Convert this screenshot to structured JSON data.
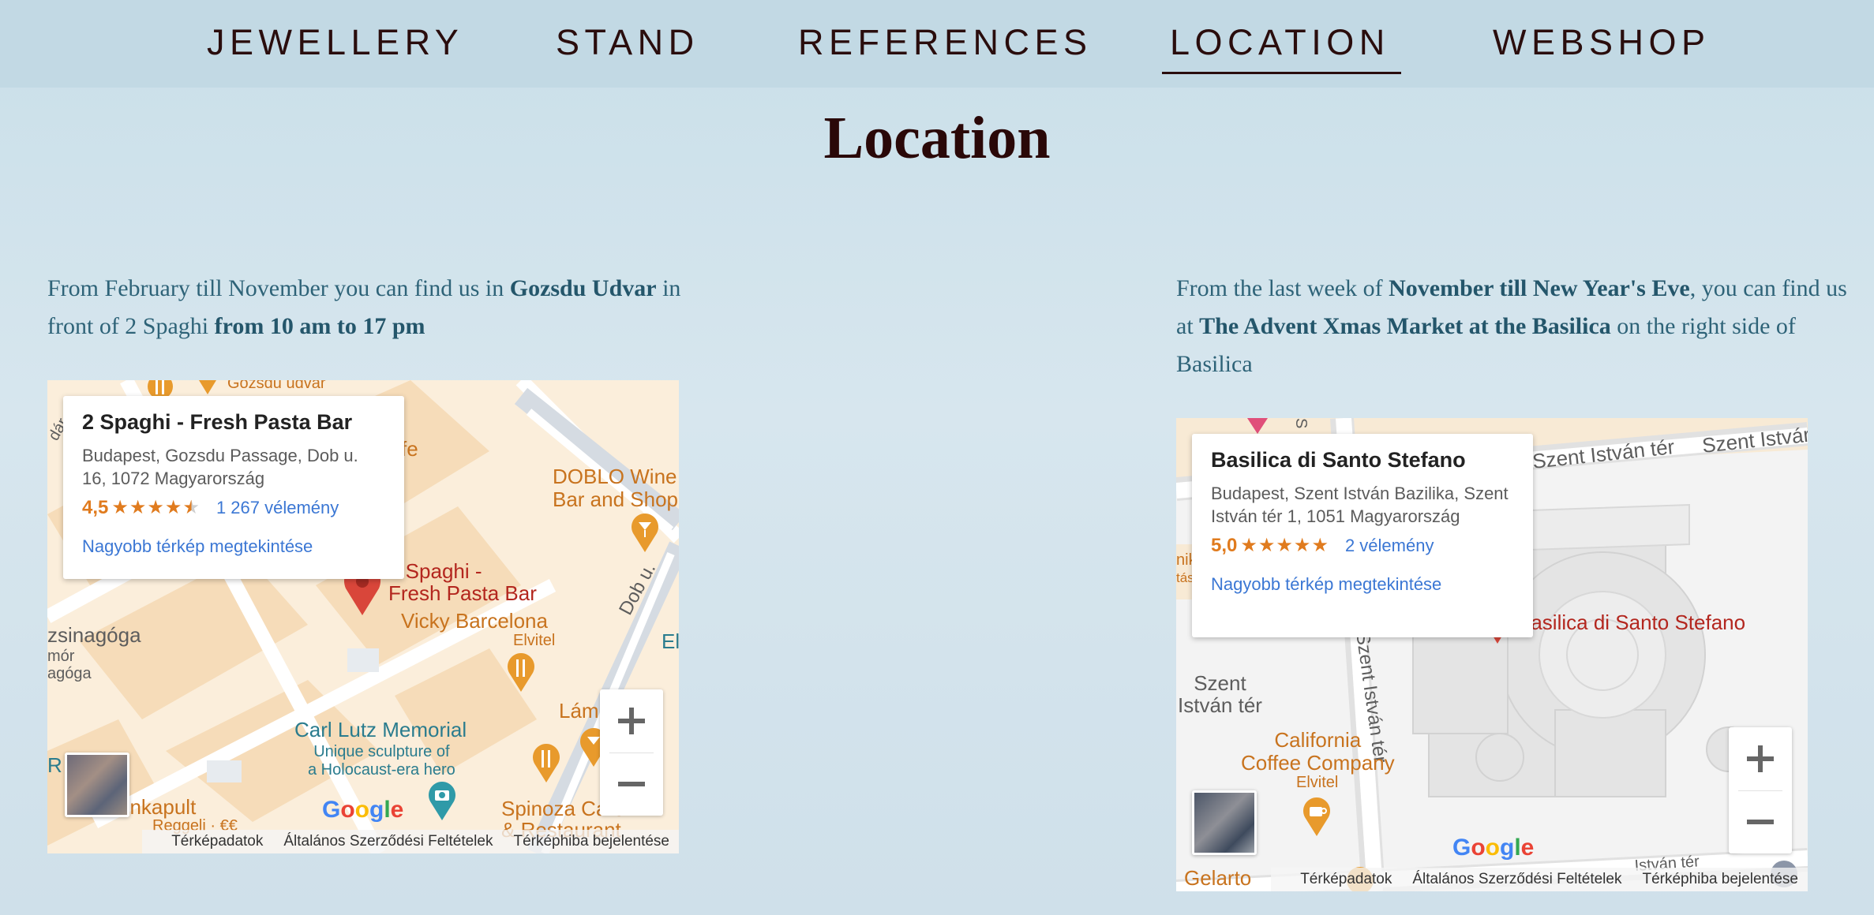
{
  "nav": {
    "items": [
      {
        "label": "JEWELLERY"
      },
      {
        "label": "STAND"
      },
      {
        "label": "REFERENCES"
      },
      {
        "label": "LOCATION"
      },
      {
        "label": "WEBSHOP"
      }
    ],
    "active": "LOCATION"
  },
  "page_title": "Location",
  "left": {
    "text_1": "From February till November you can find us in ",
    "text_bold_1": "Gozsdu Udvar",
    "text_2": " in front of 2 Spaghi ",
    "text_bold_2": "from 10 am to 17 pm",
    "map": {
      "card_name": "2 Spaghi - Fresh Pasta Bar",
      "card_address": "Budapest, Gozsdu Passage, Dob u. 16, 1072 Magyarország",
      "rating": "4,5",
      "stars": "★★★★★",
      "rating_fraction": 0.9,
      "reviews": "1 267 vélemény",
      "larger_map_link": "Nagyobb térkép megtekintése",
      "labels": {
        "place_marker": "2 Spaghi -\nFresh Pasta Bar",
        "doblo": "DOBLO Wine\nBar and Shop",
        "vicky": "Vicky Barcelona",
        "elvitel": "Elvitel",
        "zsinagoga": "zsinagóga",
        "mor": "mór",
        "agoga": "agóga",
        "carl_lutz": "Carl Lutz Memorial",
        "carl_lutz_sub": "Unique sculpture of\na Holocaust-era hero",
        "dob_u": "Dob u.",
        "lam": "Lám",
        "spinoza": "Spinoza Café\n& Restaurant",
        "r_haz": "R     ház",
        "onkapult": "onkapult",
        "regeli": "Reggeli · €€",
        "gozsdu_udvar": "Gozsdu udvar",
        "fe": "fe",
        "el": "El",
        "dar": "dár"
      },
      "footer": {
        "map_data": "Térképadatok",
        "terms": "Általános Szerződési Feltételek",
        "report": "Térképhiba bejelentése"
      },
      "google": "Google"
    }
  },
  "right": {
    "text_1": "From the last week of ",
    "text_bold_1": "November till New Year's Eve",
    "text_2": ", you can find us at ",
    "text_bold_2": "The Advent Xmas Market at the Basilica",
    "text_3": " on the right side of Basilica",
    "map": {
      "card_name": "Basilica di Santo Stefano",
      "card_address": "Budapest, Szent István Bazilika, Szent István tér 1, 1051 Magyarország",
      "rating": "5,0",
      "stars": "★★★★★",
      "rating_fraction": 1.0,
      "reviews": "2 vélemény",
      "larger_map_link": "Nagyobb térkép megtekintése",
      "labels": {
        "basilica": "Basilica di Santo Stefano",
        "szent_istvan_ter_top": "Szent István tér",
        "szent_istvan_top_right": "Szent Istvár",
        "szent_istvan_ter_side": "Szent\nIstván tér",
        "szent_istvan_vertical": "Szent István tér",
        "california": "California\nCoffee Company",
        "elvitel": "Elvitel",
        "gelarto": "Gelarto",
        "vertical_s": "S",
        "nik": "nik",
        "tas": "tás",
        "istvan_bottom": "István tér"
      },
      "footer": {
        "map_data": "Térképadatok",
        "terms": "Általános Szerződési Feltételek",
        "report": "Térképhiba bejelentése"
      },
      "google": "Google"
    }
  },
  "colors": {
    "nav_bg": "#c2d9e4",
    "nav_text": "#2a0d0d",
    "title": "#2a0808",
    "body_text": "#2e6378",
    "rating_orange": "#e07b1e",
    "link_blue": "#3b77d4",
    "marker_red": "#d9463a"
  }
}
